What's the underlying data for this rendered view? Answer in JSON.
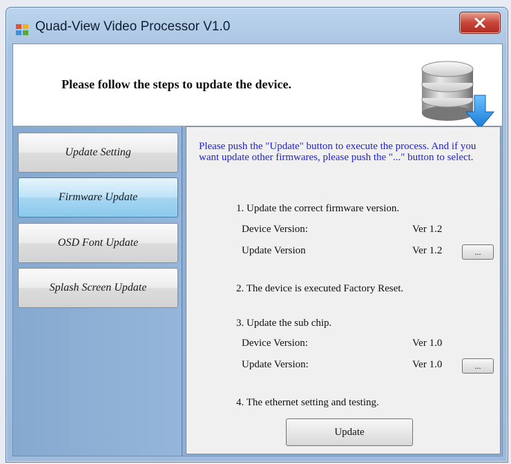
{
  "window": {
    "title": "Quad-View Video Processor V1.0",
    "close_label": "X"
  },
  "header": {
    "message": "Please follow the steps to update the device."
  },
  "sidebar": {
    "items": [
      {
        "label": "Update Setting",
        "active": false
      },
      {
        "label": "Firmware Update",
        "active": true
      },
      {
        "label": "OSD Font Update",
        "active": false
      },
      {
        "label": "Splash Screen Update",
        "active": false
      }
    ]
  },
  "panel": {
    "instructions": "Please push the \"Update\" button to execute the process. And if you want update other firmwares, please push the \"...\" button to select.",
    "step1": "1. Update the correct firmware version.",
    "step1_device_label": "Device Version:",
    "step1_device_value": "Ver 1.2",
    "step1_update_label": "Update Version",
    "step1_update_value": "Ver 1.2",
    "browse_label": "...",
    "step2": "2. The device is executed Factory Reset.",
    "step3": "3. Update the sub chip.",
    "step3_device_label": "Device Version:",
    "step3_device_value": "Ver 1.0",
    "step3_update_label": "Update Version:",
    "step3_update_value": "Ver 1.0",
    "step4": "4. The ethernet setting and testing.",
    "update_button": "Update"
  },
  "colors": {
    "instruction_text": "#1f1fd6",
    "active_nav": "#a5d6f1",
    "sidebar_bg": "#8fb0d4",
    "close_button": "#c8453a"
  },
  "icons": [
    "app-icon",
    "close-icon",
    "database-download-icon"
  ]
}
